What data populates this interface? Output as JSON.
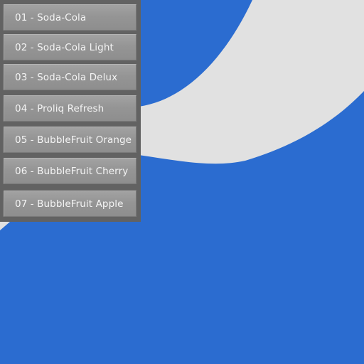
{
  "background": {
    "color": "#2b6cd0",
    "swoosh_color": "#e1e1e1"
  },
  "menu": {
    "panel_color": "#626262",
    "button_color": "#969696",
    "text_color": "#f4f4f4",
    "items": [
      {
        "label": "01 - Soda-Cola"
      },
      {
        "label": "02 - Soda-Cola Light"
      },
      {
        "label": "03 - Soda-Cola Delux"
      },
      {
        "label": "04 - Proliq Refresh"
      },
      {
        "label": "05 - BubbleFruit Orange"
      },
      {
        "label": "06 - BubbleFruit Cherry"
      },
      {
        "label": "07 - BubbleFruit Apple"
      }
    ]
  }
}
